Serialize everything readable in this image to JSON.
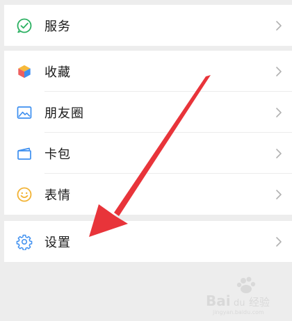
{
  "menu": {
    "group1": [
      {
        "label": "服务",
        "icon": "wechat-pay-check-icon",
        "color": "#2ab061"
      }
    ],
    "group2": [
      {
        "label": "收藏",
        "icon": "cube-icon"
      },
      {
        "label": "朋友圈",
        "icon": "picture-icon",
        "color": "#3d8ff0"
      },
      {
        "label": "卡包",
        "icon": "card-wallet-icon",
        "color": "#3d8ff0"
      },
      {
        "label": "表情",
        "icon": "smiley-icon",
        "color": "#f2b233"
      }
    ],
    "group3": [
      {
        "label": "设置",
        "icon": "gear-icon",
        "color": "#3d8ff0"
      }
    ]
  },
  "annotation": {
    "arrow_color": "#e8343a"
  }
}
